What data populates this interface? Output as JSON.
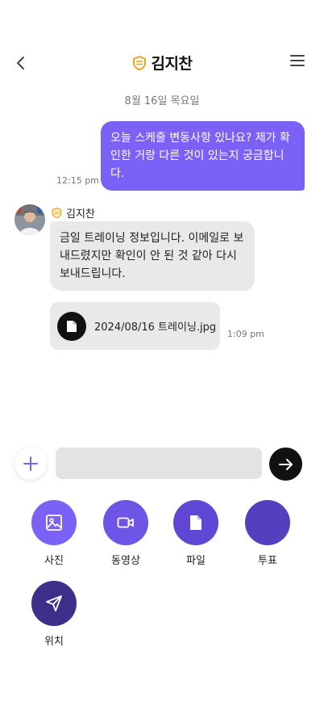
{
  "header": {
    "title": "김지찬",
    "back_icon": "chevron-left-icon",
    "menu_icon": "hamburger-menu-icon",
    "badge_icon": "shield-badge-icon",
    "badge_color": "#f2a417"
  },
  "date_separator": "8월 16일 목요일",
  "messages": {
    "outgoing": {
      "text": "오늘 스케줄 변동사항 있나요? 제가 확인한 거랑 다른 것이 있는지 궁금합니다.",
      "time": "12:15 pm"
    },
    "incoming": {
      "sender": "김지찬",
      "text": "금일 트레이닝 정보입니다. 이메일로 보내드렸지만 확인이 안 된 것 같아 다시 보내드립니다."
    },
    "file": {
      "name": "2024/08/16 트레이닝.jpg",
      "time": "1:09 pm",
      "icon": "document-icon"
    }
  },
  "input": {
    "value": "",
    "placeholder": "",
    "plus_icon": "plus-icon",
    "send_icon": "arrow-right-icon"
  },
  "attachments": [
    {
      "label": "사진",
      "icon": "image-icon",
      "color": "#7b61f5"
    },
    {
      "label": "동영상",
      "icon": "video-icon",
      "color": "#6f55e6"
    },
    {
      "label": "파일",
      "icon": "file-icon",
      "color": "#5f46d4"
    },
    {
      "label": "투표",
      "icon": "poll-icon",
      "color": "#5440bf"
    },
    {
      "label": "위치",
      "icon": "send-location-icon",
      "color": "#3d2f8a"
    }
  ],
  "colors": {
    "accent": "#7b61f5",
    "bubble_in": "#e9e9e9",
    "send_button": "#111111"
  }
}
